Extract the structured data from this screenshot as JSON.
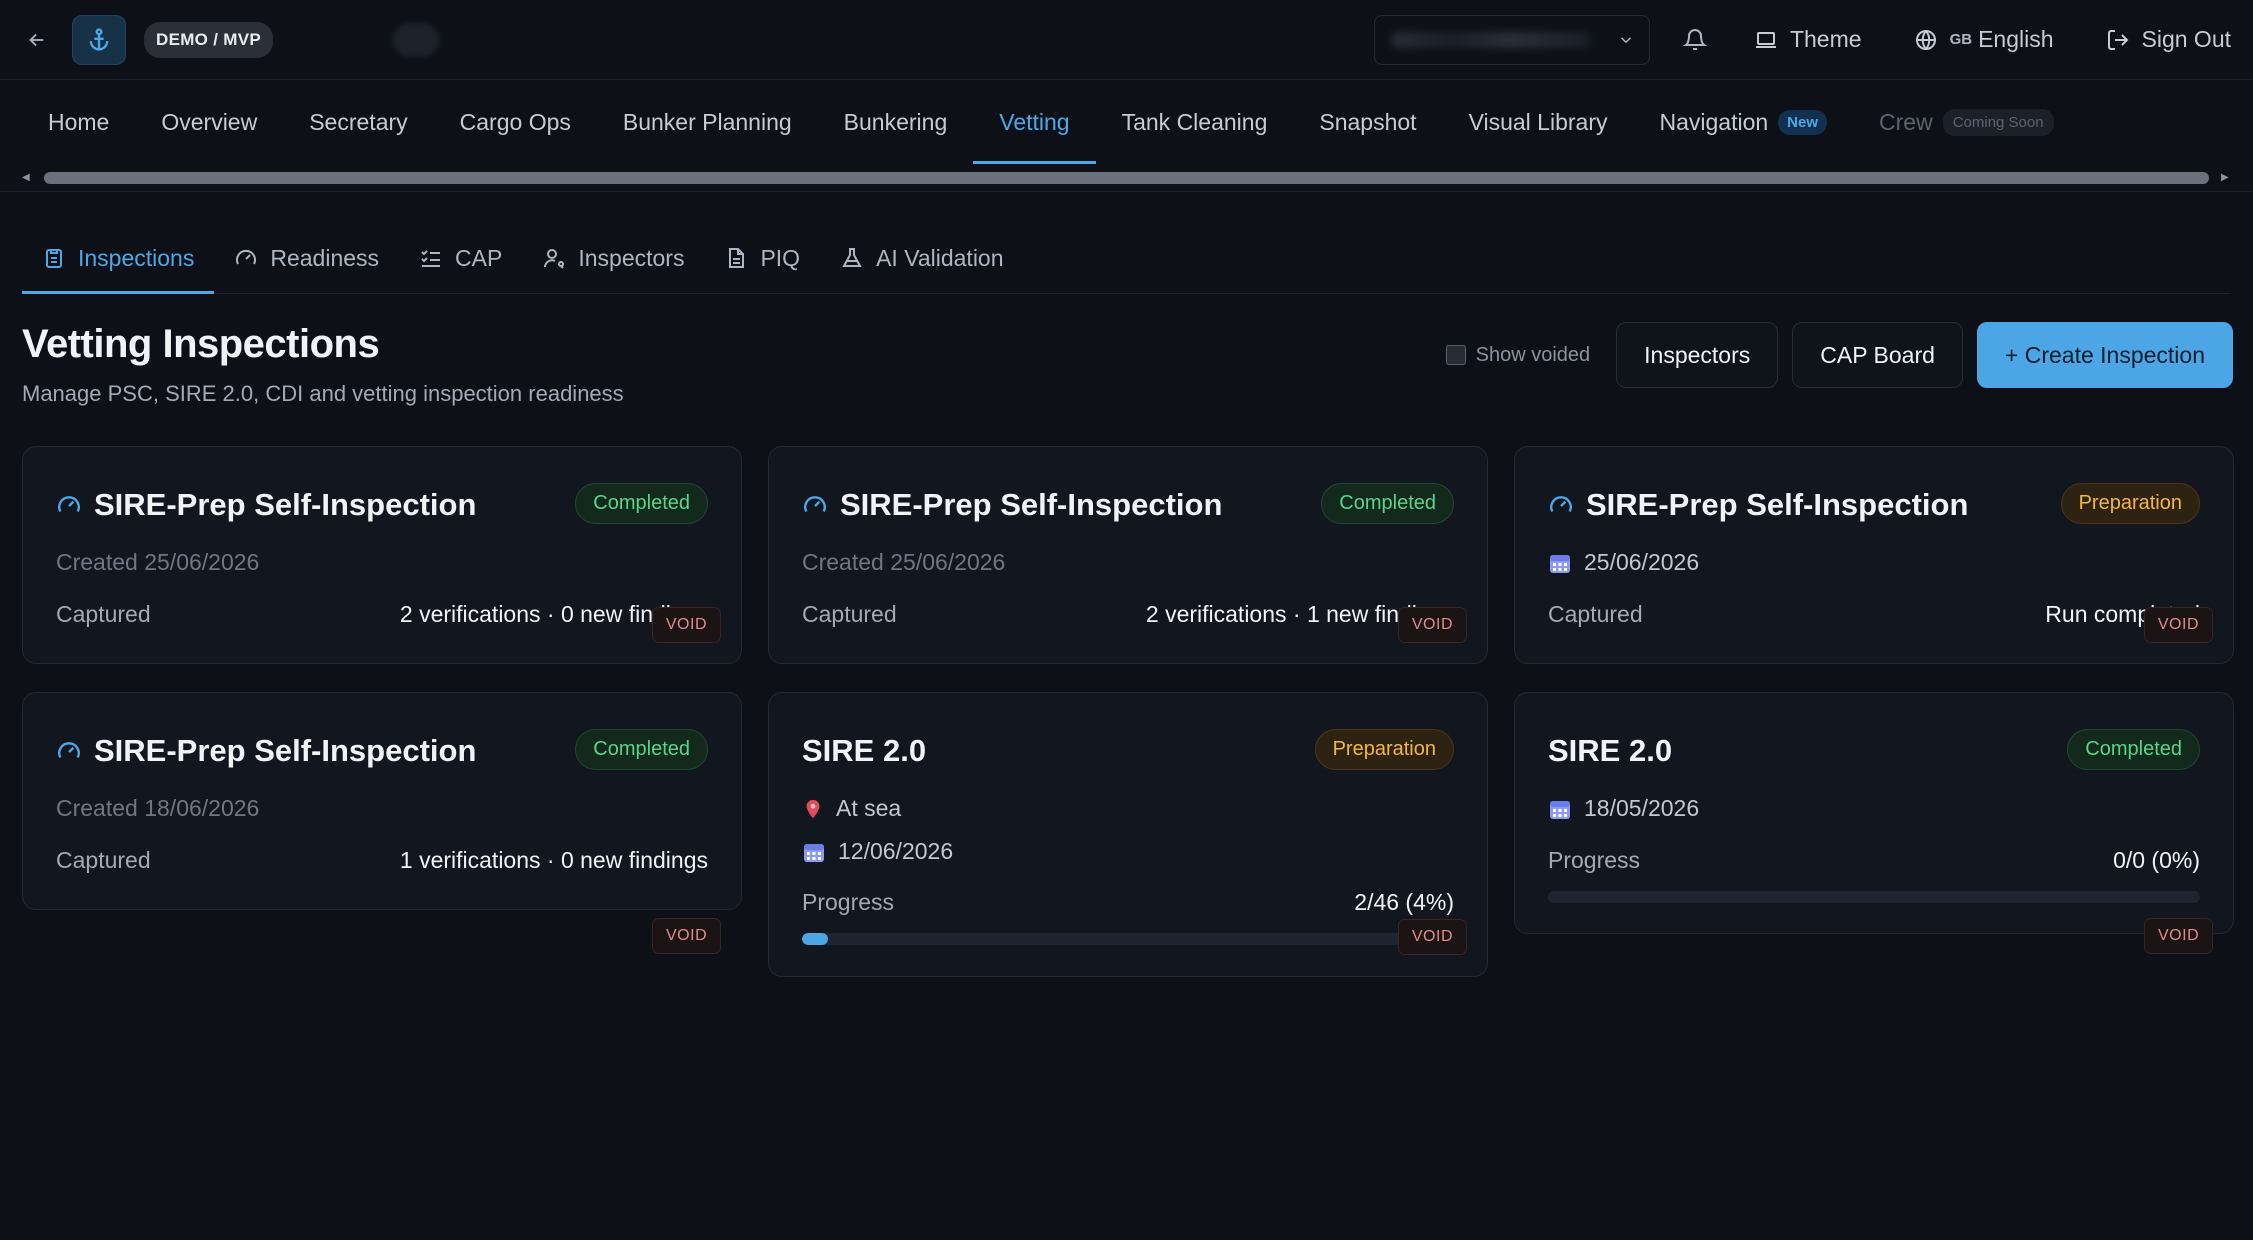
{
  "topbar": {
    "demo_label": "DEMO / MVP",
    "theme_label": "Theme",
    "lang_code": "GB",
    "lang_label": "English",
    "signout_label": "Sign Out"
  },
  "nav": {
    "items": [
      {
        "label": "Home"
      },
      {
        "label": "Overview"
      },
      {
        "label": "Secretary"
      },
      {
        "label": "Cargo Ops"
      },
      {
        "label": "Bunker Planning"
      },
      {
        "label": "Bunkering"
      },
      {
        "label": "Vetting"
      },
      {
        "label": "Tank Cleaning"
      },
      {
        "label": "Snapshot"
      },
      {
        "label": "Visual Library"
      },
      {
        "label": "Navigation",
        "badge": "New"
      },
      {
        "label": "Crew",
        "badge": "Coming Soon"
      }
    ]
  },
  "subtabs": [
    {
      "label": "Inspections"
    },
    {
      "label": "Readiness"
    },
    {
      "label": "CAP"
    },
    {
      "label": "Inspectors"
    },
    {
      "label": "PIQ"
    },
    {
      "label": "AI Validation"
    }
  ],
  "header": {
    "title": "Vetting Inspections",
    "subtitle": "Manage PSC, SIRE 2.0, CDI and vetting inspection readiness",
    "show_voided": "Show voided",
    "inspectors_btn": "Inspectors",
    "cap_board_btn": "CAP Board",
    "create_btn": "+ Create Inspection"
  },
  "cards": [
    {
      "title": "SIRE-Prep Self-Inspection",
      "status": "Completed",
      "line1": "Created 25/06/2026",
      "row_key": "Captured",
      "row_val": "2 verifications · 0 new findings",
      "void": "VOID"
    },
    {
      "title": "SIRE-Prep Self-Inspection",
      "status": "Completed",
      "line1": "Created 25/06/2026",
      "row_key": "Captured",
      "row_val": "2 verifications · 1 new findings",
      "void": "VOID"
    },
    {
      "title": "SIRE-Prep Self-Inspection",
      "status": "Preparation",
      "line1": "25/06/2026",
      "row_key": "Captured",
      "row_val": "Run completed",
      "void": "VOID"
    },
    {
      "title": "SIRE-Prep Self-Inspection",
      "status": "Completed",
      "line1": "Created 18/06/2026",
      "row_key": "Captured",
      "row_val": "1 verifications · 0 new findings",
      "void": "VOID"
    },
    {
      "title": "SIRE 2.0",
      "status": "Preparation",
      "location": "At sea",
      "date": "12/06/2026",
      "row_key": "Progress",
      "row_val": "2/46 (4%)",
      "progress": 0.04,
      "void": "VOID"
    },
    {
      "title": "SIRE 2.0",
      "status": "Completed",
      "date": "18/05/2026",
      "row_key": "Progress",
      "row_val": "0/0 (0%)",
      "progress": 0,
      "void": "VOID"
    }
  ]
}
